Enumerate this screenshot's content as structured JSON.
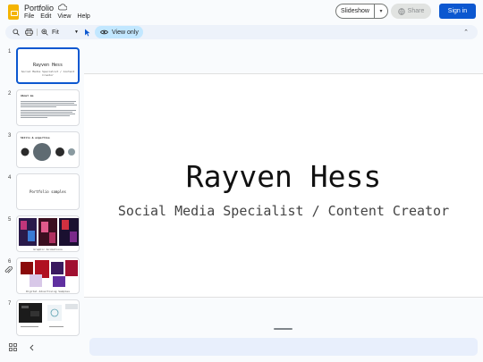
{
  "app": {
    "title": "Portfolio",
    "menu": [
      "File",
      "Edit",
      "View",
      "Help"
    ]
  },
  "header": {
    "slideshow_label": "Slideshow",
    "share_label": "Share",
    "signin_label": "Sign in"
  },
  "toolbar": {
    "zoom_value": "Fit",
    "view_only_label": "View only"
  },
  "colors": {
    "accent": "#0b57d0",
    "view_only_bg": "#c2e7ff",
    "logo": "#f4b400"
  },
  "icons": {
    "logo": "slides-logo-icon",
    "cloud": "cloud-icon",
    "search": "search-icon",
    "print": "print-icon",
    "zoom": "zoom-icon",
    "select": "cursor-icon",
    "eye": "eye-icon",
    "collapse": "chevron-up-icon",
    "attach": "attachment-icon",
    "grid": "grid-view-icon",
    "back": "chevron-left-icon"
  },
  "slides": [
    {
      "num": "1",
      "title": "Rayven Hess",
      "subtitle": "Social Media Specialist / Content Creator"
    },
    {
      "num": "2",
      "title": "About me"
    },
    {
      "num": "3",
      "title": "Skills & expertise"
    },
    {
      "num": "4",
      "title": "Portfolio samples"
    },
    {
      "num": "5",
      "caption": "Graphic Animations"
    },
    {
      "num": "6",
      "caption": "Digital Advertising Samples"
    },
    {
      "num": "7"
    }
  ],
  "current_slide": {
    "title": "Rayven Hess",
    "subtitle": "Social Media Specialist / Content Creator"
  }
}
